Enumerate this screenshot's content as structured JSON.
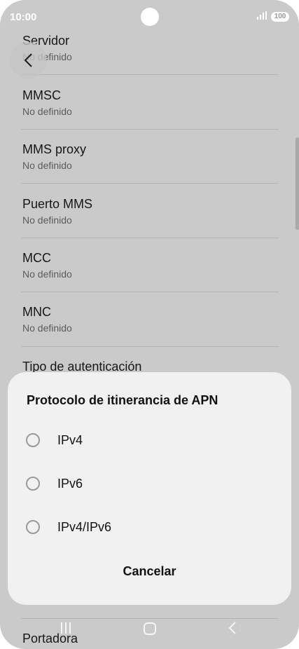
{
  "status": {
    "time": "10:00",
    "signal_icon": "signal-icon",
    "battery": "100"
  },
  "back": {
    "icon": "chevron-left-icon"
  },
  "list": {
    "items": [
      {
        "title": "Servidor",
        "subtitle": "No definido"
      },
      {
        "title": "MMSC",
        "subtitle": "No definido"
      },
      {
        "title": "MMS proxy",
        "subtitle": "No definido"
      },
      {
        "title": "Puerto MMS",
        "subtitle": "No definido"
      },
      {
        "title": "MCC",
        "subtitle": "No definido"
      },
      {
        "title": "MNC",
        "subtitle": "No definido"
      },
      {
        "title": "Tipo de autenticación",
        "subtitle": ""
      }
    ],
    "footer_item": "Portadora"
  },
  "dialog": {
    "title": "Protocolo de itinerancia de APN",
    "options": [
      {
        "label": "IPv4",
        "selected": false
      },
      {
        "label": "IPv6",
        "selected": false
      },
      {
        "label": "IPv4/IPv6",
        "selected": false
      }
    ],
    "cancel": "Cancelar"
  },
  "nav": {
    "recent_icon": "recent-apps-icon",
    "home_icon": "home-icon",
    "back_icon": "back-icon"
  }
}
